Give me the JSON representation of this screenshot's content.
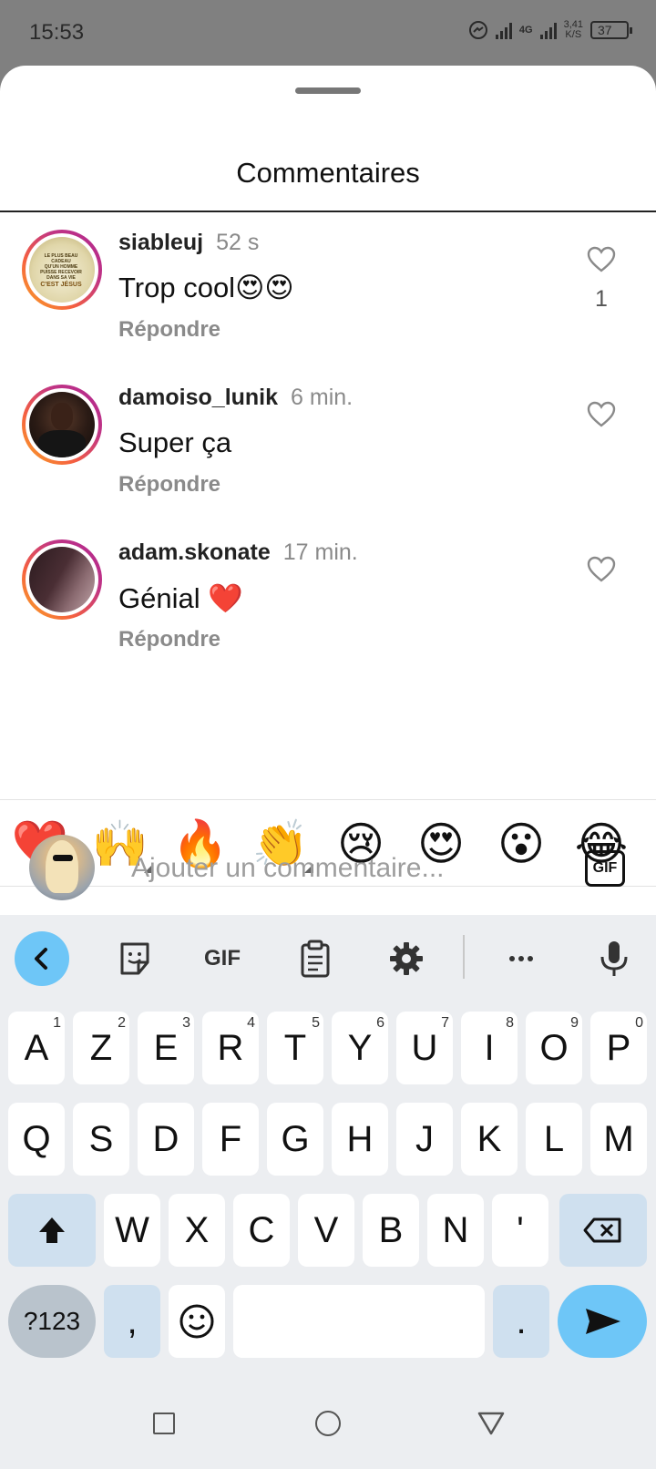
{
  "status_bar": {
    "time": "15:53",
    "network": "4G",
    "speed_value": "3,41",
    "speed_unit": "K/S",
    "battery": "37"
  },
  "sheet": {
    "title": "Commentaires"
  },
  "comments": [
    {
      "username": "siableuj",
      "time": "52 s",
      "text": "Trop cool😍😍",
      "reply": "Répondre",
      "likes": "1",
      "avatar_poster": [
        "LE PLUS BEAU CADEAU",
        "QU'UN HOMME PUISSE RECEVOIR",
        "DANS SA VIE",
        "C'EST JÉSUS"
      ]
    },
    {
      "username": "damoiso_lunik",
      "time": "6 min.",
      "text": "Super ça",
      "reply": "Répondre",
      "likes": ""
    },
    {
      "username": "adam.skonate",
      "time": "17 min.",
      "text": "Génial ❤️",
      "reply": "Répondre",
      "likes": ""
    }
  ],
  "emoji_bar": [
    "❤️",
    "🙌",
    "🔥",
    "👏",
    "😢",
    "😍",
    "😮",
    "😂"
  ],
  "input": {
    "placeholder": "Ajouter un commentaire...",
    "gif_label": "GIF"
  },
  "keyboard": {
    "toolbar_gif": "GIF",
    "row1": [
      {
        "k": "A",
        "n": "1"
      },
      {
        "k": "Z",
        "n": "2"
      },
      {
        "k": "E",
        "n": "3"
      },
      {
        "k": "R",
        "n": "4"
      },
      {
        "k": "T",
        "n": "5"
      },
      {
        "k": "Y",
        "n": "6"
      },
      {
        "k": "U",
        "n": "7"
      },
      {
        "k": "I",
        "n": "8"
      },
      {
        "k": "O",
        "n": "9"
      },
      {
        "k": "P",
        "n": "0"
      }
    ],
    "row2": [
      "Q",
      "S",
      "D",
      "F",
      "G",
      "H",
      "J",
      "K",
      "L",
      "M"
    ],
    "row3": [
      "W",
      "X",
      "C",
      "V",
      "B",
      "N",
      "'"
    ],
    "sym_label": "?123",
    "comma": ",",
    "period": "."
  },
  "colors": {
    "accent_blue": "#6ec6f7",
    "avatar_ring_start": "#f9a825",
    "avatar_ring_end": "#b0268f",
    "heart_red": "#e3262f"
  }
}
